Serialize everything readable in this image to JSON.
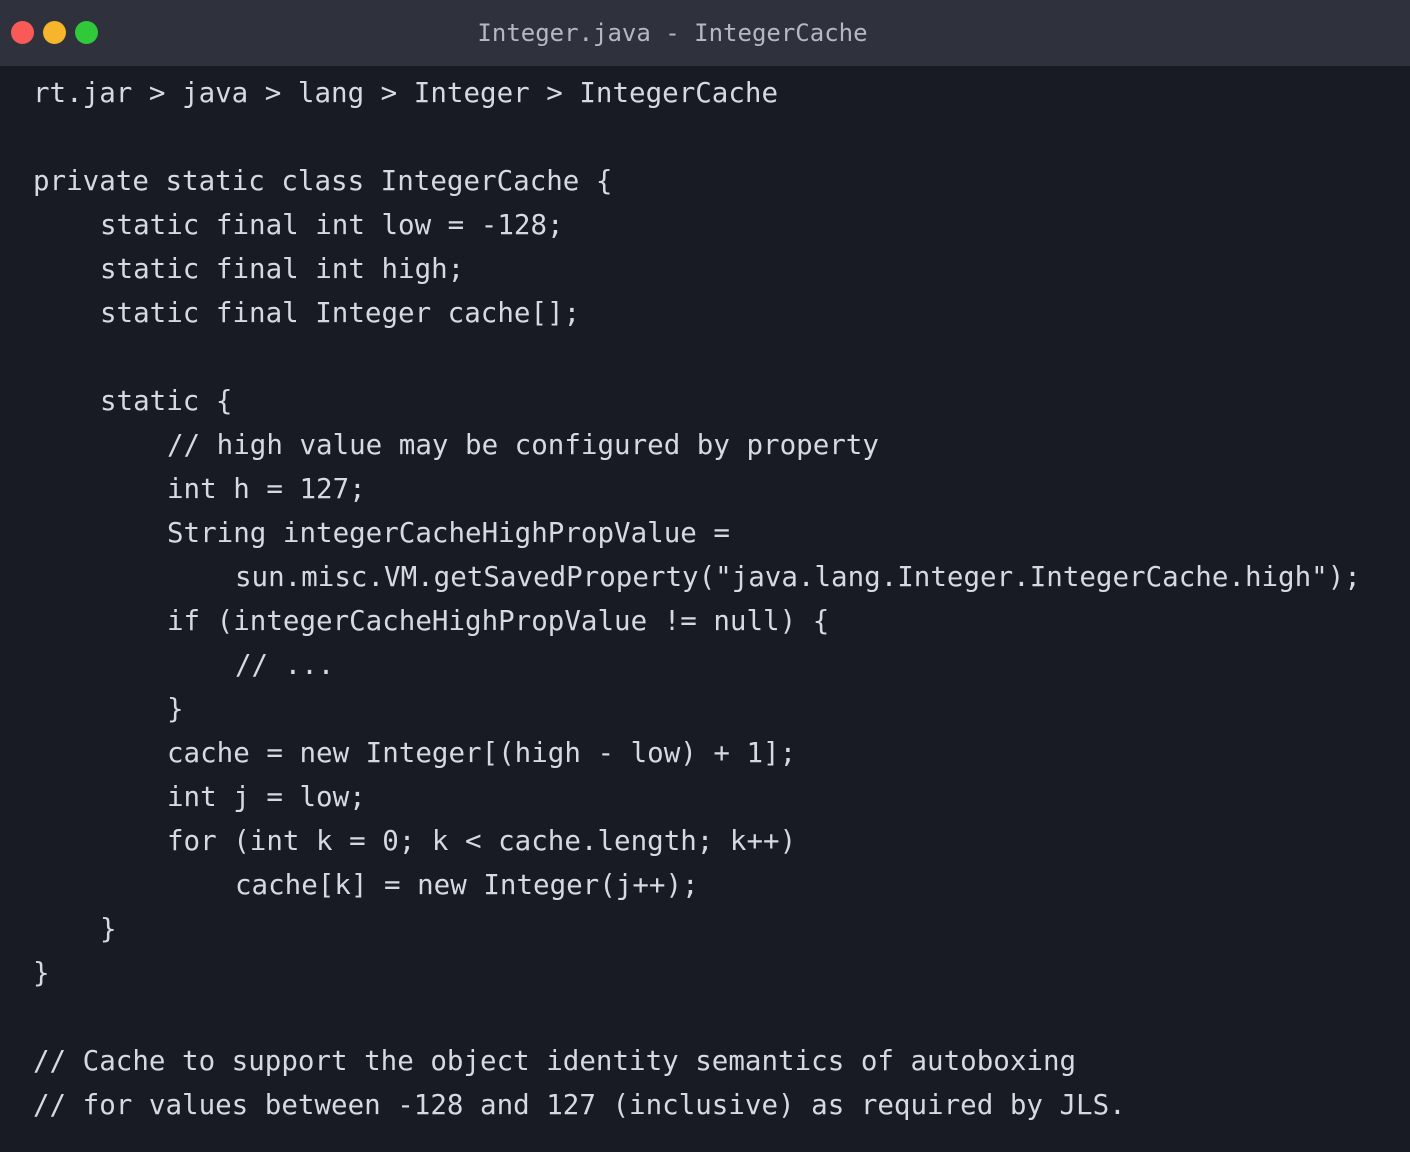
{
  "window": {
    "title": "Integer.java - IntegerCache"
  },
  "breadcrumb": "rt.jar > java > lang > Integer > IntegerCache",
  "code": {
    "lines": [
      "private static class IntegerCache {",
      "static final int low = -128;",
      "static final int high;",
      "static final Integer cache[];",
      "static {",
      "// high value may be configured by property",
      "int h = 127;",
      "String integerCacheHighPropValue =",
      "sun.misc.VM.getSavedProperty(\"java.lang.Integer.IntegerCache.high\");",
      "if (integerCacheHighPropValue != null) {",
      "// ...",
      "}",
      "cache = new Integer[(high - low) + 1];",
      "int j = low;",
      "for (int k = 0; k < cache.length; k++)",
      "cache[k] = new Integer(j++);",
      "}",
      "}",
      "// Cache to support the object identity semantics of autoboxing",
      "// for values between -128 and 127 (inclusive) as required by JLS."
    ]
  },
  "colors": {
    "background": "#181b24",
    "titlebar": "#2f323c",
    "text": "#d6d9df",
    "close": "#fa5a57",
    "minimize": "#f6b52b",
    "maximize": "#2fc93a"
  }
}
